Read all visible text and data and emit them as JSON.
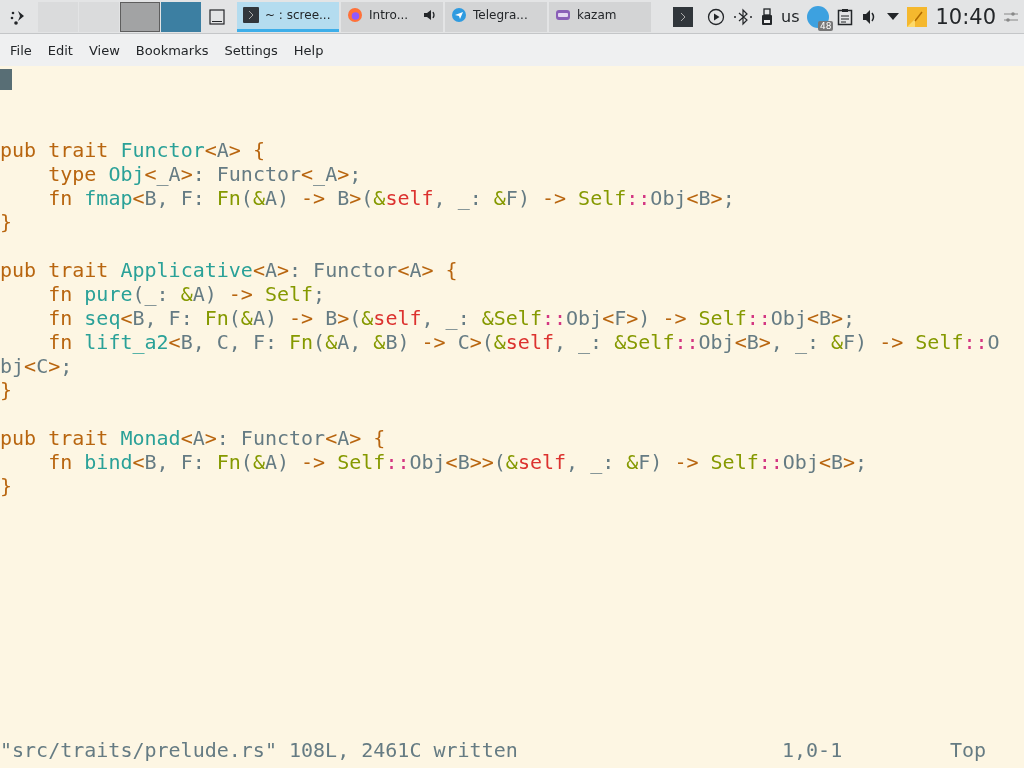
{
  "taskbar": {
    "desktops": [
      {
        "selected": false
      },
      {
        "selected": false
      },
      {
        "selected": false
      },
      {
        "selected": true
      }
    ],
    "tasks": [
      {
        "kind": "terminal",
        "label": "~ : scree...",
        "selected": true,
        "audio": false
      },
      {
        "kind": "browser",
        "label": "Intro...",
        "selected": false,
        "audio": true
      },
      {
        "kind": "messenger",
        "label": "Telegra...",
        "selected": false,
        "audio": false
      },
      {
        "kind": "recorder",
        "label": "kazam",
        "selected": false,
        "audio": false
      }
    ],
    "keyboard_layout": "us",
    "messenger_badge": "48",
    "clock": "10:40"
  },
  "menu": [
    "File",
    "Edit",
    "View",
    "Bookmarks",
    "Settings",
    "Help"
  ],
  "editor": {
    "blocks": [
      [
        [
          {
            "kind": "keyword",
            "text": "pub trait "
          },
          {
            "kind": "name",
            "text": "Functor"
          },
          {
            "kind": "keyword",
            "text": "<"
          },
          {
            "kind": "plain",
            "text": "A"
          },
          {
            "kind": "keyword",
            "text": "> {"
          }
        ],
        [
          {
            "kind": "keyword",
            "text": "    type "
          },
          {
            "kind": "name",
            "text": "Obj"
          },
          {
            "kind": "keyword",
            "text": "<"
          },
          {
            "kind": "plain",
            "text": "_A"
          },
          {
            "kind": "keyword",
            "text": ">"
          },
          {
            "kind": "plain",
            "text": ": Functor"
          },
          {
            "kind": "keyword",
            "text": "<"
          },
          {
            "kind": "plain",
            "text": "_A"
          },
          {
            "kind": "keyword",
            "text": ">"
          },
          {
            "kind": "plain",
            "text": ";"
          }
        ],
        [
          {
            "kind": "keyword",
            "text": "    fn "
          },
          {
            "kind": "name",
            "text": "fmap"
          },
          {
            "kind": "keyword",
            "text": "<"
          },
          {
            "kind": "plain",
            "text": "B, F: "
          },
          {
            "kind": "builtin",
            "text": "Fn"
          },
          {
            "kind": "plain",
            "text": "("
          },
          {
            "kind": "builtin",
            "text": "&"
          },
          {
            "kind": "plain",
            "text": "A) "
          },
          {
            "kind": "keyword",
            "text": "->"
          },
          {
            "kind": "plain",
            "text": " B"
          },
          {
            "kind": "keyword",
            "text": ">"
          },
          {
            "kind": "plain",
            "text": "("
          },
          {
            "kind": "builtin",
            "text": "&"
          },
          {
            "kind": "self",
            "text": "self"
          },
          {
            "kind": "plain",
            "text": ", _: "
          },
          {
            "kind": "builtin",
            "text": "&"
          },
          {
            "kind": "plain",
            "text": "F) "
          },
          {
            "kind": "keyword",
            "text": "-> "
          },
          {
            "kind": "builtin",
            "text": "Self"
          },
          {
            "kind": "path",
            "text": "::"
          },
          {
            "kind": "plain",
            "text": "Obj"
          },
          {
            "kind": "keyword",
            "text": "<"
          },
          {
            "kind": "plain",
            "text": "B"
          },
          {
            "kind": "keyword",
            "text": ">"
          },
          {
            "kind": "plain",
            "text": ";"
          }
        ],
        [
          {
            "kind": "keyword",
            "text": "}"
          }
        ]
      ],
      [
        [
          {
            "kind": "keyword",
            "text": "pub trait "
          },
          {
            "kind": "name",
            "text": "Applicative"
          },
          {
            "kind": "keyword",
            "text": "<"
          },
          {
            "kind": "plain",
            "text": "A"
          },
          {
            "kind": "keyword",
            "text": ">"
          },
          {
            "kind": "plain",
            "text": ": Functor"
          },
          {
            "kind": "keyword",
            "text": "<"
          },
          {
            "kind": "plain",
            "text": "A"
          },
          {
            "kind": "keyword",
            "text": "> {"
          }
        ],
        [
          {
            "kind": "keyword",
            "text": "    fn "
          },
          {
            "kind": "name",
            "text": "pure"
          },
          {
            "kind": "plain",
            "text": "(_: "
          },
          {
            "kind": "builtin",
            "text": "&"
          },
          {
            "kind": "plain",
            "text": "A) "
          },
          {
            "kind": "keyword",
            "text": "-> "
          },
          {
            "kind": "builtin",
            "text": "Self"
          },
          {
            "kind": "plain",
            "text": ";"
          }
        ],
        [
          {
            "kind": "keyword",
            "text": "    fn "
          },
          {
            "kind": "name",
            "text": "seq"
          },
          {
            "kind": "keyword",
            "text": "<"
          },
          {
            "kind": "plain",
            "text": "B, F: "
          },
          {
            "kind": "builtin",
            "text": "Fn"
          },
          {
            "kind": "plain",
            "text": "("
          },
          {
            "kind": "builtin",
            "text": "&"
          },
          {
            "kind": "plain",
            "text": "A) "
          },
          {
            "kind": "keyword",
            "text": "->"
          },
          {
            "kind": "plain",
            "text": " B"
          },
          {
            "kind": "keyword",
            "text": ">"
          },
          {
            "kind": "plain",
            "text": "("
          },
          {
            "kind": "builtin",
            "text": "&"
          },
          {
            "kind": "self",
            "text": "self"
          },
          {
            "kind": "plain",
            "text": ", _: "
          },
          {
            "kind": "builtin",
            "text": "&Self"
          },
          {
            "kind": "path",
            "text": "::"
          },
          {
            "kind": "plain",
            "text": "Obj"
          },
          {
            "kind": "keyword",
            "text": "<"
          },
          {
            "kind": "plain",
            "text": "F"
          },
          {
            "kind": "keyword",
            "text": ">"
          },
          {
            "kind": "plain",
            "text": ") "
          },
          {
            "kind": "keyword",
            "text": "-> "
          },
          {
            "kind": "builtin",
            "text": "Self"
          },
          {
            "kind": "path",
            "text": "::"
          },
          {
            "kind": "plain",
            "text": "Obj"
          },
          {
            "kind": "keyword",
            "text": "<"
          },
          {
            "kind": "plain",
            "text": "B"
          },
          {
            "kind": "keyword",
            "text": ">"
          },
          {
            "kind": "plain",
            "text": ";"
          }
        ],
        [
          {
            "kind": "keyword",
            "text": "    fn "
          },
          {
            "kind": "name",
            "text": "lift_a2"
          },
          {
            "kind": "keyword",
            "text": "<"
          },
          {
            "kind": "plain",
            "text": "B, C, F: "
          },
          {
            "kind": "builtin",
            "text": "Fn"
          },
          {
            "kind": "plain",
            "text": "("
          },
          {
            "kind": "builtin",
            "text": "&"
          },
          {
            "kind": "plain",
            "text": "A, "
          },
          {
            "kind": "builtin",
            "text": "&"
          },
          {
            "kind": "plain",
            "text": "B) "
          },
          {
            "kind": "keyword",
            "text": "->"
          },
          {
            "kind": "plain",
            "text": " C"
          },
          {
            "kind": "keyword",
            "text": ">"
          },
          {
            "kind": "plain",
            "text": "("
          },
          {
            "kind": "builtin",
            "text": "&"
          },
          {
            "kind": "self",
            "text": "self"
          },
          {
            "kind": "plain",
            "text": ", _: "
          },
          {
            "kind": "builtin",
            "text": "&Self"
          },
          {
            "kind": "path",
            "text": "::"
          },
          {
            "kind": "plain",
            "text": "Obj"
          },
          {
            "kind": "keyword",
            "text": "<"
          },
          {
            "kind": "plain",
            "text": "B"
          },
          {
            "kind": "keyword",
            "text": ">"
          },
          {
            "kind": "plain",
            "text": ", _: "
          },
          {
            "kind": "builtin",
            "text": "&"
          },
          {
            "kind": "plain",
            "text": "F) "
          },
          {
            "kind": "keyword",
            "text": "-> "
          },
          {
            "kind": "builtin",
            "text": "Self"
          },
          {
            "kind": "path",
            "text": "::"
          },
          {
            "kind": "plain",
            "text": "O"
          }
        ],
        [
          {
            "kind": "plain",
            "text": "bj"
          },
          {
            "kind": "keyword",
            "text": "<"
          },
          {
            "kind": "plain",
            "text": "C"
          },
          {
            "kind": "keyword",
            "text": ">"
          },
          {
            "kind": "plain",
            "text": ";"
          }
        ],
        [
          {
            "kind": "keyword",
            "text": "}"
          }
        ]
      ],
      [
        [
          {
            "kind": "keyword",
            "text": "pub trait "
          },
          {
            "kind": "name",
            "text": "Monad"
          },
          {
            "kind": "keyword",
            "text": "<"
          },
          {
            "kind": "plain",
            "text": "A"
          },
          {
            "kind": "keyword",
            "text": ">"
          },
          {
            "kind": "plain",
            "text": ": Functor"
          },
          {
            "kind": "keyword",
            "text": "<"
          },
          {
            "kind": "plain",
            "text": "A"
          },
          {
            "kind": "keyword",
            "text": "> {"
          }
        ],
        [
          {
            "kind": "keyword",
            "text": "    fn "
          },
          {
            "kind": "name",
            "text": "bind"
          },
          {
            "kind": "keyword",
            "text": "<"
          },
          {
            "kind": "plain",
            "text": "B, F: "
          },
          {
            "kind": "builtin",
            "text": "Fn"
          },
          {
            "kind": "plain",
            "text": "("
          },
          {
            "kind": "builtin",
            "text": "&"
          },
          {
            "kind": "plain",
            "text": "A) "
          },
          {
            "kind": "keyword",
            "text": "-> "
          },
          {
            "kind": "builtin",
            "text": "Self"
          },
          {
            "kind": "path",
            "text": "::"
          },
          {
            "kind": "plain",
            "text": "Obj"
          },
          {
            "kind": "keyword",
            "text": "<"
          },
          {
            "kind": "plain",
            "text": "B"
          },
          {
            "kind": "keyword",
            "text": ">>"
          },
          {
            "kind": "plain",
            "text": "("
          },
          {
            "kind": "builtin",
            "text": "&"
          },
          {
            "kind": "self",
            "text": "self"
          },
          {
            "kind": "plain",
            "text": ", _: "
          },
          {
            "kind": "builtin",
            "text": "&"
          },
          {
            "kind": "plain",
            "text": "F) "
          },
          {
            "kind": "keyword",
            "text": "-> "
          },
          {
            "kind": "builtin",
            "text": "Self"
          },
          {
            "kind": "path",
            "text": "::"
          },
          {
            "kind": "plain",
            "text": "Obj"
          },
          {
            "kind": "keyword",
            "text": "<"
          },
          {
            "kind": "plain",
            "text": "B"
          },
          {
            "kind": "keyword",
            "text": ">"
          },
          {
            "kind": "plain",
            "text": ";"
          }
        ],
        [
          {
            "kind": "keyword",
            "text": "}"
          }
        ]
      ]
    ],
    "status_message": "\"src/traits/prelude.rs\" 108L, 2461C written",
    "position": "1,0-1",
    "scroll": "Top"
  }
}
